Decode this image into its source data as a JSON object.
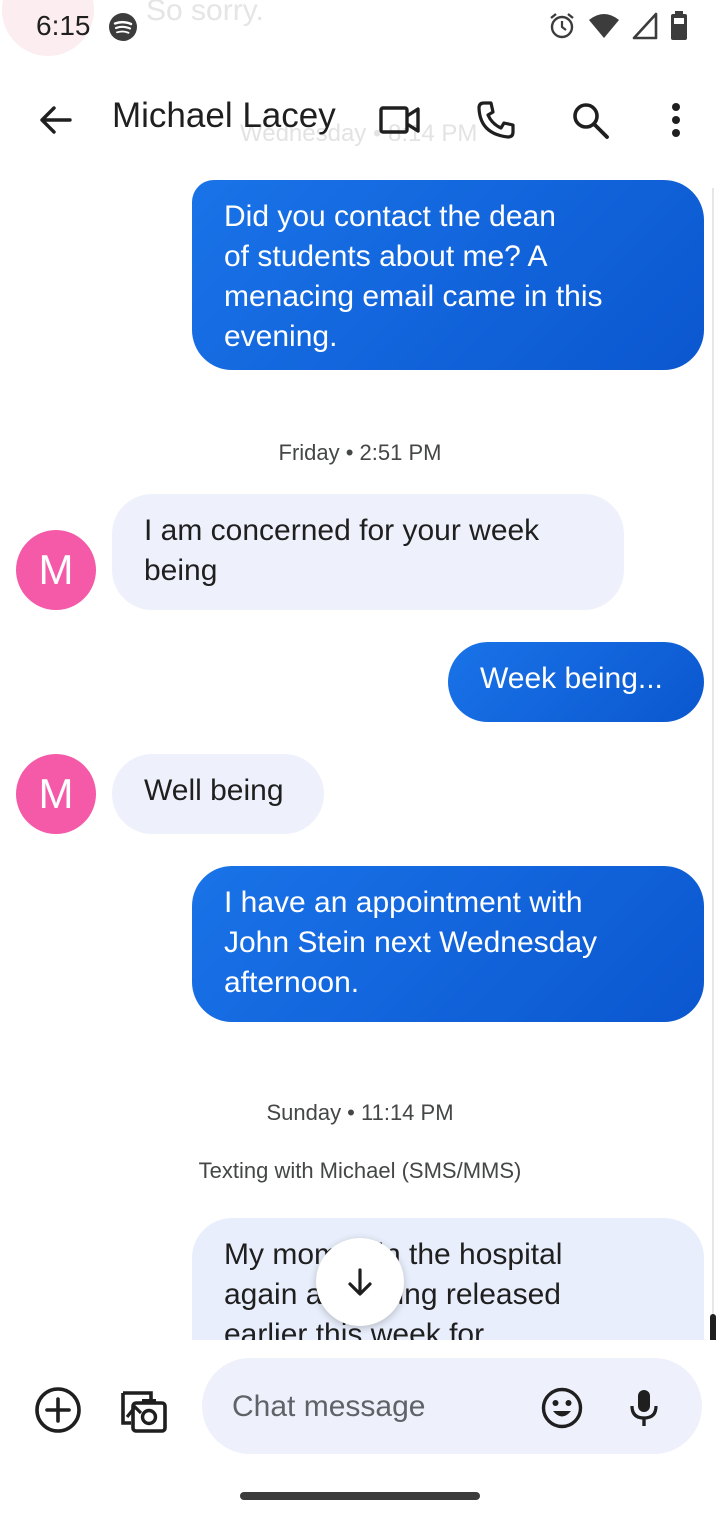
{
  "status_bar": {
    "time": "6:15",
    "notification_peek_text": "So sorry."
  },
  "header": {
    "contact_name": "Michael Lacey",
    "ghost_date": "Wednesday • 8:14 PM"
  },
  "messages": [
    {
      "type": "outgoing",
      "lines": [
        "Did you contact the dean",
        "of students about me? A",
        "menacing email came in this",
        "evening."
      ]
    },
    {
      "type": "timestamp",
      "text": "Friday • 2:51 PM"
    },
    {
      "type": "incoming",
      "avatar_letter": "M",
      "lines": [
        "I am concerned for your week",
        "being"
      ]
    },
    {
      "type": "outgoing",
      "lines": [
        "Week being..."
      ]
    },
    {
      "type": "incoming",
      "avatar_letter": "M",
      "lines": [
        "Well being"
      ]
    },
    {
      "type": "outgoing",
      "lines": [
        "I have an appointment with",
        "John Stein next Wednesday",
        "afternoon."
      ]
    },
    {
      "type": "timestamp",
      "text": "Sunday • 11:14 PM"
    },
    {
      "type": "info",
      "text": "Texting with Michael (SMS/MMS)"
    },
    {
      "type": "outgoing_partial",
      "lines": [
        "My mom is in the hospital",
        "again and being released",
        "earlier this week for"
      ]
    }
  ],
  "composer": {
    "placeholder": "Chat message"
  },
  "colors": {
    "outgoing_bubble": "#1a73e8",
    "incoming_bubble": "#eef1fb",
    "avatar": "#f45aa8"
  },
  "icons": {
    "back": "arrow-left",
    "video": "video-camera",
    "call": "phone",
    "search": "magnifier",
    "more": "three-dots-vertical",
    "scroll_down": "arrow-down",
    "add": "plus-circle",
    "media": "gallery-camera",
    "emoji": "smiley",
    "mic": "microphone"
  }
}
